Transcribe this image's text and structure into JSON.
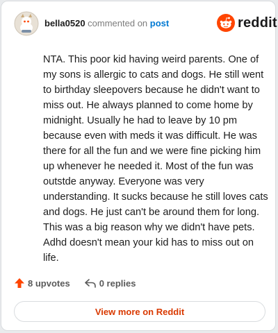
{
  "header": {
    "username": "bella0520",
    "commented_on": "commented on",
    "post_link": "post",
    "brand_name": "reddit"
  },
  "comment": {
    "text": "NTA. This poor kid having weird parents. One of my sons is allergic to cats and dogs. He still went to birthday sleepovers because he didn't want to miss out. He always planned to come home by midnight. Usually he had to leave by 10 pm because even with meds it was difficult. He was there for all the fun and we were fine picking him up whenever he needed it. Most of the fun was outstde anyway. Everyone was very understanding. It sucks because he still loves cats and dogs. He just can't be around them for long. This was a big reason why we didn't have pets. Adhd doesn't mean your kid has to miss out on life."
  },
  "footer": {
    "upvotes": "8 upvotes",
    "replies": "0 replies",
    "upvote_icon": "upvote-arrow-icon",
    "reply_icon": "reply-arrow-icon"
  },
  "cta": {
    "label": "View more on Reddit"
  },
  "colors": {
    "brand_orange": "#ff4500",
    "link_blue": "#0079d3",
    "cta_red": "#d93900",
    "text": "#1c1c1c",
    "muted": "#7c7c7c"
  }
}
